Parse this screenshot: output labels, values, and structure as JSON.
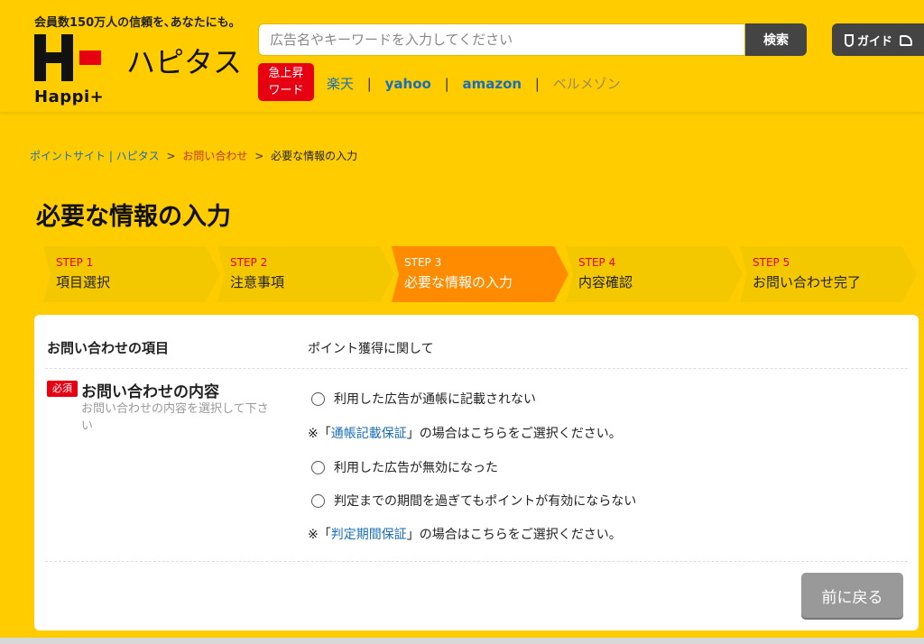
{
  "header": {
    "tagline": "会員数150万人の信頼を､あなたにも｡",
    "logo_word": "Happi+",
    "logo_kana": "ハピタス",
    "search_placeholder": "広告名やキーワードを入力してください",
    "search_button": "検索",
    "guide_button": "ガイド",
    "rising_badge_line1": "急上昇",
    "rising_badge_line2": "ワード",
    "trend_links": [
      "楽天",
      "yahoo",
      "amazon",
      "ベルメゾン"
    ],
    "separator": "|"
  },
  "breadcrumb": {
    "home": "ポイントサイト | ハピタス",
    "inquiry": "お問い合わせ",
    "current": "必要な情報の入力",
    "gt": ">"
  },
  "page_title": "必要な情報の入力",
  "steps": [
    {
      "num": "STEP 1",
      "title": "項目選択"
    },
    {
      "num": "STEP 2",
      "title": "注意事項"
    },
    {
      "num": "STEP 3",
      "title": "必要な情報の入力"
    },
    {
      "num": "STEP 4",
      "title": "内容確認"
    },
    {
      "num": "STEP 5",
      "title": "お問い合わせ完了"
    }
  ],
  "active_step_index": 2,
  "colors": {
    "brand_yellow": "#ffcc00",
    "step_inactive": "#f3c800",
    "step_active": "#ff8c00",
    "accent_red": "#e60012",
    "link_blue": "#1a6fb8"
  },
  "form": {
    "item_label": "お問い合わせの項目",
    "item_value": "ポイント獲得に関して",
    "required_badge": "必須",
    "content_label": "お問い合わせの内容",
    "content_help": "お問い合わせの内容を選択して下さい",
    "options": [
      "利用した広告が通帳に記載されない",
      "利用した広告が無効になった",
      "判定までの期間を過ぎてもポイントが有効にならない"
    ],
    "note1_prefix": "※「",
    "note1_link": "通帳記載保証",
    "note1_suffix": "」の場合はこちらをご選択ください。",
    "note2_prefix": "※「",
    "note2_link": "判定期間保証",
    "note2_suffix": "」の場合はこちらをご選択ください。",
    "back_button": "前に戻る"
  }
}
